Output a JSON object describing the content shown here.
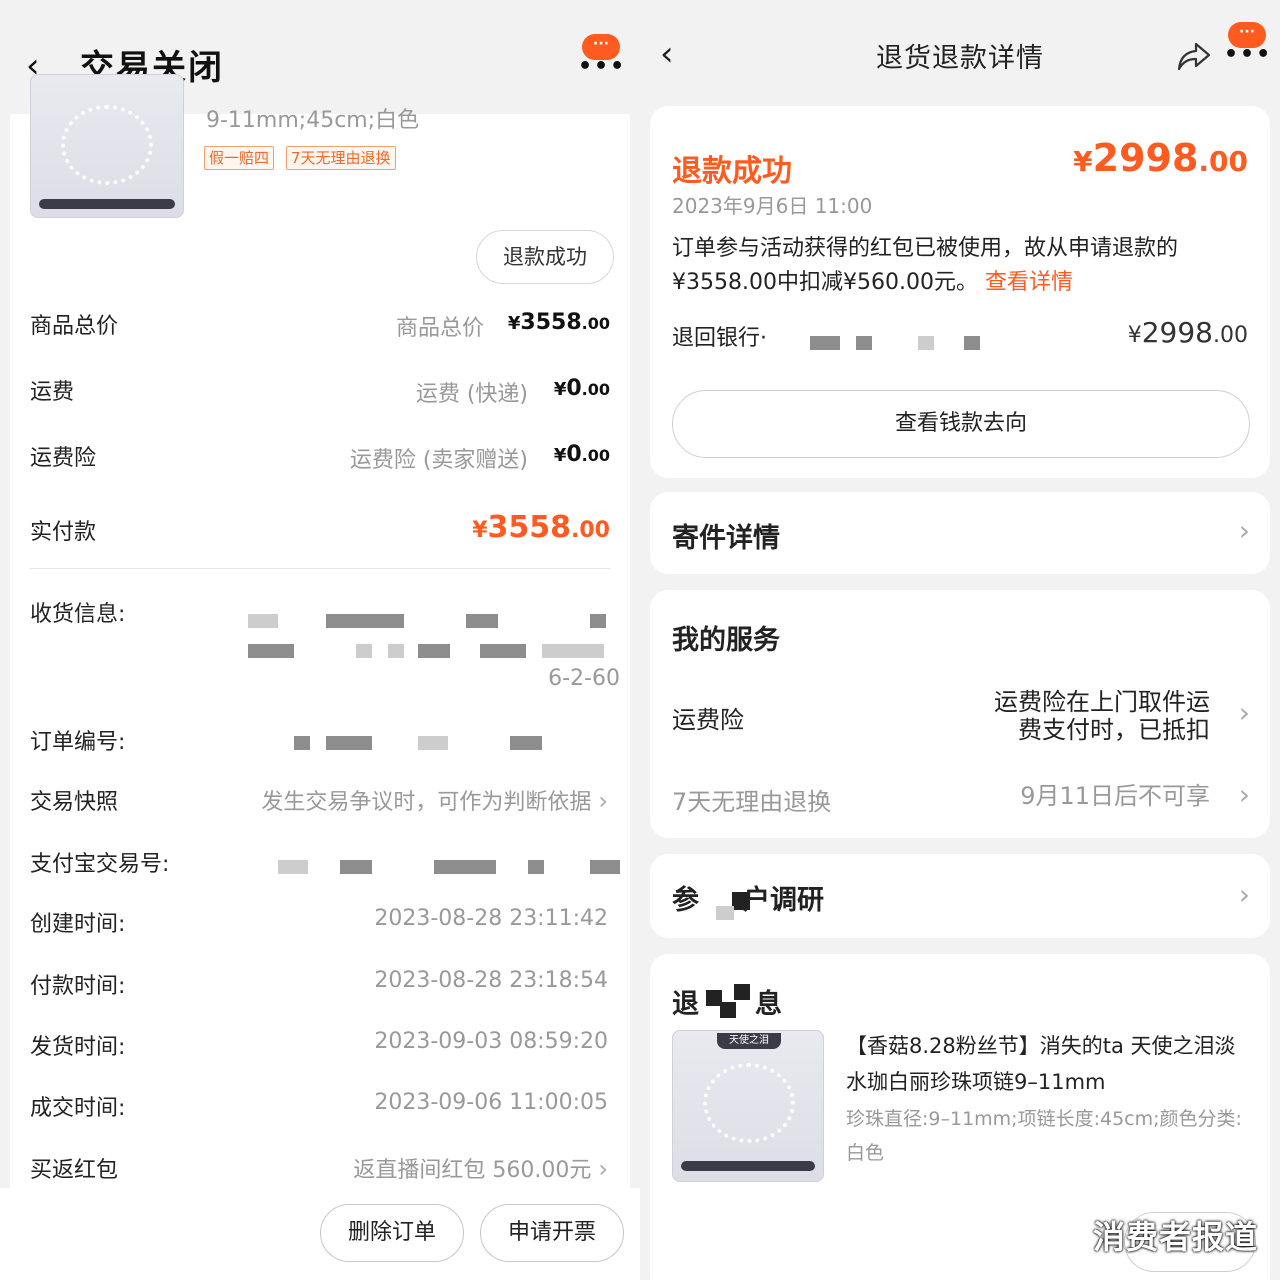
{
  "left": {
    "header": {
      "back_icon": "chevron-left-icon",
      "title": "交易关闭",
      "more_bubble": "···",
      "more_dots": "•••"
    },
    "product": {
      "spec_fragment": "9-11mm;45cm;白色",
      "tags": [
        "假一赔四",
        "7天无理由退换"
      ],
      "status_button": "退款成功"
    },
    "prices": [
      {
        "label": "商品总价",
        "sub": "商品总价",
        "cur": "¥",
        "int": "3558",
        "dec": ".00"
      },
      {
        "label": "运费",
        "sub": "运费 (快递)",
        "cur": "¥",
        "int": "0",
        "dec": ".00"
      },
      {
        "label": "运费险",
        "sub": "运费险 (卖家赠送)",
        "cur": "¥",
        "int": "0",
        "dec": ".00"
      }
    ],
    "paid": {
      "label": "实付款",
      "cur": "¥",
      "int": "3558",
      "dec": ".00"
    },
    "info": {
      "shipping_label": "收货信息:",
      "shipping_fragment": "6-2-60",
      "order_no_label": "订单编号:",
      "snapshot_label": "交易快照",
      "snapshot_value": "发生交易争议时，可作为判断依据",
      "alipay_label": "支付宝交易号:",
      "rows": [
        {
          "label": "创建时间:",
          "value": "2023-08-28 23:11:42"
        },
        {
          "label": "付款时间:",
          "value": "2023-08-28 23:18:54"
        },
        {
          "label": "发货时间:",
          "value": "2023-09-03 08:59:20"
        },
        {
          "label": "成交时间:",
          "value": "2023-09-06 11:00:05"
        }
      ],
      "redpacket_label": "买返红包",
      "redpacket_value": "返直播间红包 560.00元"
    },
    "bottom": {
      "delete": "删除订单",
      "invoice": "申请开票"
    }
  },
  "right": {
    "header": {
      "title": "退货退款详情",
      "back_icon": "chevron-left-icon",
      "share_icon": "share-icon",
      "more_bubble": "···",
      "more_dots": "•••"
    },
    "refund": {
      "title": "退款成功",
      "cur": "¥",
      "int": "2998",
      "dec": ".00",
      "time": "2023年9月6日 11:00",
      "note": "订单参与活动获得的红包已被使用，故从申请退款的¥3558.00中扣减¥560.00元。",
      "link": "查看详情",
      "bank_label": "退回银行·",
      "bank_cur": "¥",
      "bank_int": "2998",
      "bank_dec": ".00",
      "flow_button": "查看钱款去向"
    },
    "shipment": {
      "title": "寄件详情"
    },
    "services": {
      "title": "我的服务",
      "items": [
        {
          "label": "运费险",
          "value_line1": "运费险在上门取件运",
          "value_line2": "费支付时，已抵扣"
        },
        {
          "label": "7天无理由退换",
          "value_line1": "9月11日后不可享",
          "value_line2": ""
        }
      ]
    },
    "survey": {
      "title_a": "参",
      "title_b": "户调研"
    },
    "refund_info": {
      "title_a": "退",
      "title_b": "息",
      "product_title": "【香菇8.28粉丝节】消失的ta 天使之泪淡水珈白丽珍珠项链9–11mm",
      "product_spec": "珍珠直径:9–11mm;项链长度:45cm;颜色分类:白色",
      "thumb_label": "天使之泪"
    },
    "watermark": "消费者报道"
  },
  "colors": {
    "accent": "#ff5a1f",
    "background": "#f2f2f2",
    "card": "#ffffff",
    "muted": "#999999"
  }
}
